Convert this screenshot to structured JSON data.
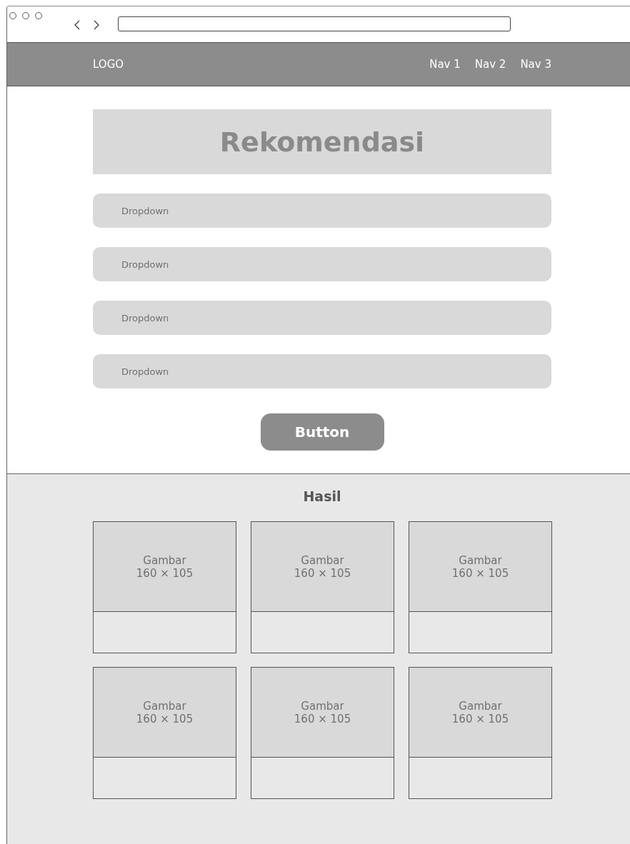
{
  "header": {
    "logo": "LOGO",
    "nav": [
      "Nav 1",
      "Nav 2",
      "Nav 3"
    ]
  },
  "title": "Rekomendasi",
  "dropdowns": [
    {
      "placeholder": "Dropdown"
    },
    {
      "placeholder": "Dropdown"
    },
    {
      "placeholder": "Dropdown"
    },
    {
      "placeholder": "Dropdown"
    }
  ],
  "button": "Button",
  "results": {
    "heading": "Hasil",
    "cards": [
      {
        "image_label": "Gambar",
        "image_size": "160 × 105"
      },
      {
        "image_label": "Gambar",
        "image_size": "160 × 105"
      },
      {
        "image_label": "Gambar",
        "image_size": "160 × 105"
      },
      {
        "image_label": "Gambar",
        "image_size": "160 × 105"
      },
      {
        "image_label": "Gambar",
        "image_size": "160 × 105"
      },
      {
        "image_label": "Gambar",
        "image_size": "160 × 105"
      }
    ]
  }
}
